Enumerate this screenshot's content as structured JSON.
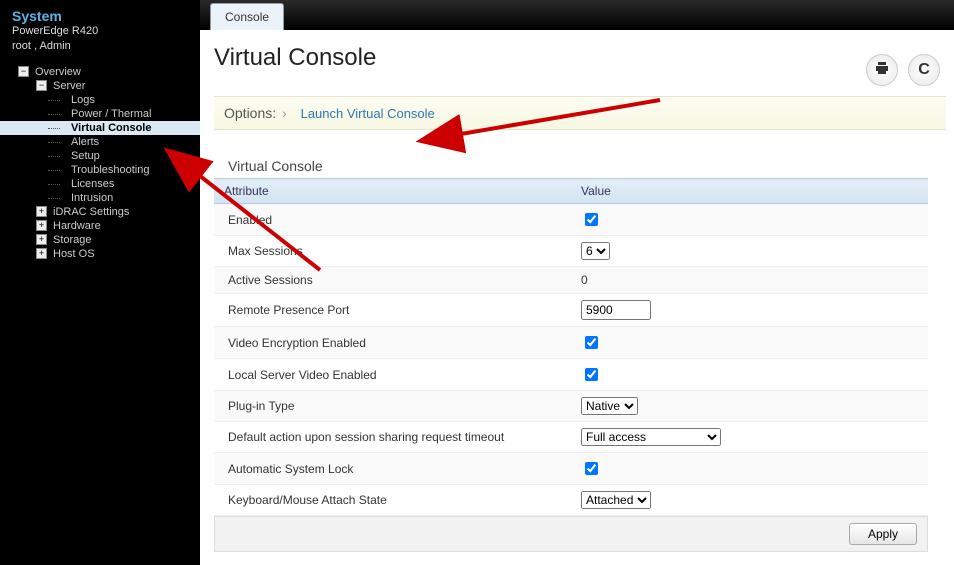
{
  "system": {
    "title": "System",
    "model": "PowerEdge R420",
    "user": "root , Admin"
  },
  "tree": {
    "overview": "Overview",
    "server": "Server",
    "server_children": {
      "logs": "Logs",
      "power_thermal": "Power / Thermal",
      "virtual_console": "Virtual Console",
      "alerts": "Alerts",
      "setup": "Setup",
      "troubleshooting": "Troubleshooting",
      "licenses": "Licenses",
      "intrusion": "Intrusion"
    },
    "idrac_settings": "iDRAC Settings",
    "hardware": "Hardware",
    "storage": "Storage",
    "host_os": "Host OS"
  },
  "tab": {
    "console": "Console"
  },
  "page": {
    "title": "Virtual Console",
    "options_label": "Options:",
    "launch_link": "Launch Virtual Console"
  },
  "section_title": "Virtual Console",
  "table": {
    "col_attribute": "Attribute",
    "col_value": "Value",
    "rows": {
      "enabled": {
        "label": "Enabled",
        "checked": true
      },
      "max_sessions": {
        "label": "Max Sessions",
        "value": "6"
      },
      "active_sessions": {
        "label": "Active Sessions",
        "value": "0"
      },
      "remote_port": {
        "label": "Remote Presence Port",
        "value": "5900"
      },
      "video_encryption": {
        "label": "Video Encryption Enabled",
        "checked": true
      },
      "local_video": {
        "label": "Local Server Video Enabled",
        "checked": true
      },
      "plugin_type": {
        "label": "Plug-in Type",
        "value": "Native"
      },
      "default_action": {
        "label": "Default action upon session sharing request timeout",
        "value": "Full access"
      },
      "auto_lock": {
        "label": "Automatic System Lock",
        "checked": true
      },
      "kb_mouse": {
        "label": "Keyboard/Mouse Attach State",
        "value": "Attached"
      }
    }
  },
  "buttons": {
    "apply": "Apply"
  },
  "chart_data": null
}
